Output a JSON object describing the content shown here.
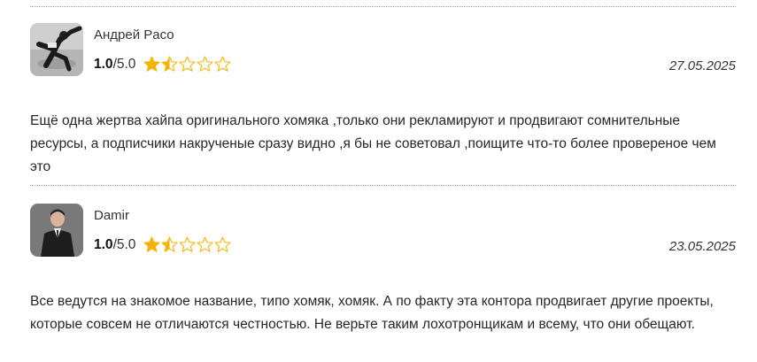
{
  "reviews": [
    {
      "author": "Андрей Pасо",
      "score": "1.0",
      "max": "/5.0",
      "stars_filled": 1.5,
      "stars_total": 5,
      "date": "27.05.2025",
      "text": "Ещё одна жертва хайпа оригинального хомяка ,только они рекламируют и продвигают сомнительные ресурсы, а подписчики накрученые сразу видно ,я бы не советовал ,поищите что-то более провереное чем это"
    },
    {
      "author": "Damir",
      "score": "1.0",
      "max": "/5.0",
      "stars_filled": 1.5,
      "stars_total": 5,
      "date": "23.05.2025",
      "text": "Все ведутся на знакомое название, типо хомяк, хомяк. А по факту эта контора продвигает другие проекты, которые совсем не отличаются честностью. Не верьте таким лохотронщикам и всему, что они обещают."
    }
  ],
  "colors": {
    "star_fill": "#f5b301",
    "star_outline": "#f5b301",
    "separator": "#9a9a9a"
  },
  "icons": {
    "star_full": "star-icon",
    "star_half": "half-star-icon",
    "star_empty": "empty-star-icon"
  }
}
